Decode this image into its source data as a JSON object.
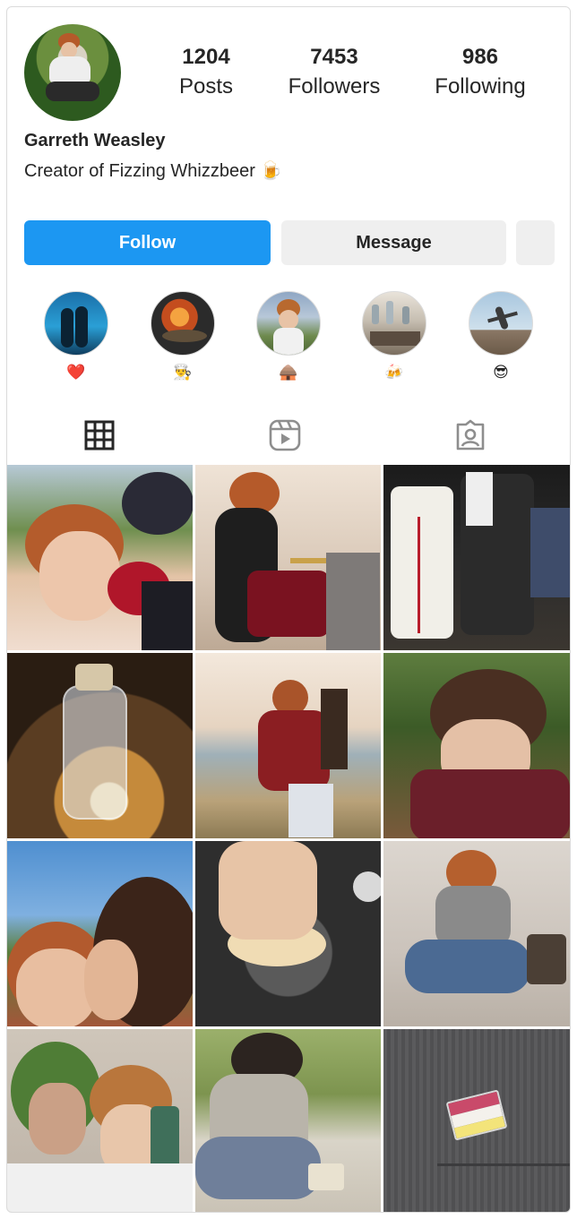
{
  "profile": {
    "name": "Garreth Weasley",
    "bio": "Creator of Fizzing Whizzbeer 🍺",
    "avatar_icon": "profile-photo"
  },
  "stats": {
    "posts": {
      "value": "1204",
      "label": "Posts"
    },
    "followers": {
      "value": "7453",
      "label": "Followers"
    },
    "following": {
      "value": "986",
      "label": "Following"
    }
  },
  "actions": {
    "follow_label": "Follow",
    "message_label": "Message",
    "follow_color": "#1c97f2"
  },
  "highlights": [
    {
      "emoji": "❤️"
    },
    {
      "emoji": "👨‍🍳"
    },
    {
      "emoji": "🛖"
    },
    {
      "emoji": "🍻"
    },
    {
      "emoji": "😎"
    }
  ],
  "tabs": [
    {
      "icon": "grid-icon",
      "active": true
    },
    {
      "icon": "reels-icon",
      "active": false
    },
    {
      "icon": "tagged-icon",
      "active": false
    }
  ],
  "posts": [
    {
      "subject": "grapes-selfie"
    },
    {
      "subject": "drummer"
    },
    {
      "subject": "sneakers"
    },
    {
      "subject": "potion-bottle"
    },
    {
      "subject": "lake-play"
    },
    {
      "subject": "forest-portrait"
    },
    {
      "subject": "kiss-selfie"
    },
    {
      "subject": "dough"
    },
    {
      "subject": "mirror-selfie"
    },
    {
      "subject": "frog-hat-selfie"
    },
    {
      "subject": "picnic"
    },
    {
      "subject": "flag-pin"
    }
  ]
}
